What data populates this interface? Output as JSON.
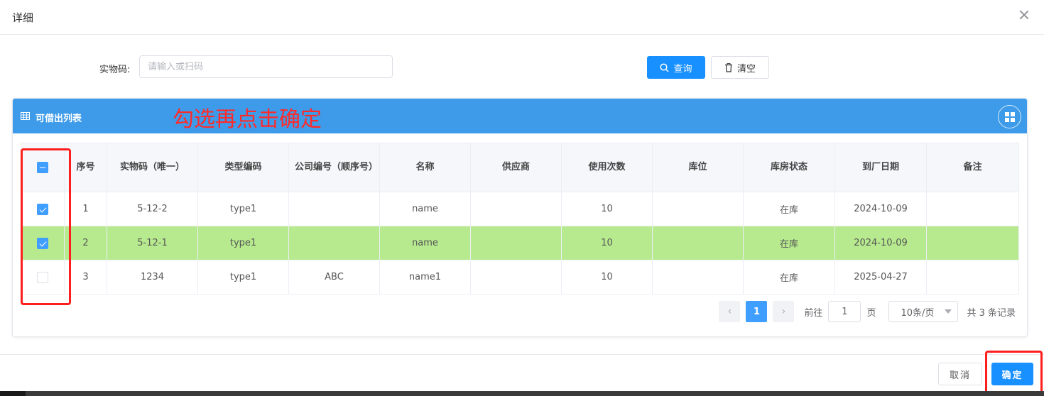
{
  "dialog": {
    "title": "详细",
    "close_icon": "close-icon"
  },
  "search": {
    "label": "实物码:",
    "placeholder": "请输入或扫码",
    "value": "",
    "query_label": "查询",
    "clear_label": "清空"
  },
  "panel": {
    "title": "可借出列表",
    "annotation": "勾选再点击确定"
  },
  "table": {
    "headers": [
      "序号",
      "实物码（唯一）",
      "类型编码",
      "公司编号（顺序号）",
      "名称",
      "供应商",
      "使用次数",
      "库位",
      "库房状态",
      "到厂日期",
      "备注"
    ],
    "header_checkbox_state": "indeterminate",
    "rows": [
      {
        "checked": true,
        "highlighted": false,
        "cells": [
          "1",
          "5-12-2",
          "type1",
          "",
          "name",
          "",
          "10",
          "",
          "在库",
          "2024-10-09",
          ""
        ]
      },
      {
        "checked": true,
        "highlighted": true,
        "cells": [
          "2",
          "5-12-1",
          "type1",
          "",
          "name",
          "",
          "10",
          "",
          "在库",
          "2024-10-09",
          ""
        ]
      },
      {
        "checked": false,
        "highlighted": false,
        "cells": [
          "3",
          "1234",
          "type1",
          "ABC",
          "name1",
          "",
          "10",
          "",
          "在库",
          "2025-04-27",
          ""
        ]
      }
    ]
  },
  "pagination": {
    "prev": "‹",
    "current_page": "1",
    "next": "›",
    "goto_prefix": "前往",
    "goto_value": "1",
    "goto_suffix": "页",
    "page_size": "10条/页",
    "total": "共 3 条记录"
  },
  "footer": {
    "cancel_label": "取消",
    "ok_label": "确定"
  },
  "colors": {
    "primary": "#1890ff",
    "panel_header": "#3d9be9",
    "highlight_row": "#b7ea8e",
    "annotation_red": "#ff1e1e"
  }
}
